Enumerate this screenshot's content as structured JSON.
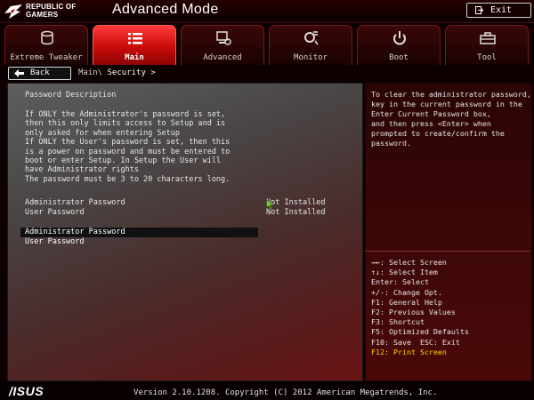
{
  "header": {
    "brand_line1": "REPUBLIC OF",
    "brand_line2": "GAMERS",
    "title": "Advanced Mode",
    "exit_label": "Exit"
  },
  "tabs": [
    {
      "label": "Extreme Tweaker",
      "icon": "extreme-tweaker-icon",
      "active": false
    },
    {
      "label": "Main",
      "icon": "menu-list-icon",
      "active": true
    },
    {
      "label": "Advanced",
      "icon": "advanced-icon",
      "active": false
    },
    {
      "label": "Monitor",
      "icon": "monitor-icon",
      "active": false
    },
    {
      "label": "Boot",
      "icon": "power-icon",
      "active": false
    },
    {
      "label": "Tool",
      "icon": "toolbox-icon",
      "active": false
    }
  ],
  "nav": {
    "back_label": "Back",
    "crumb_parent": "Main\\",
    "crumb_current": "Security >"
  },
  "main": {
    "desc_title": "Password Description",
    "desc_lines": [
      "If ONLY the Administrator's password is set,",
      "then this only limits access to Setup and is",
      "only asked for when entering Setup",
      "If ONLY the User's password is set, then this",
      "is a power on password and must be entered to",
      "boot or enter Setup. In Setup the User will",
      "have Administrator rights",
      "The password must be 3 to 20 characters long."
    ],
    "status_rows": [
      {
        "label": "Administrator Password",
        "value": "Not Installed"
      },
      {
        "label": "User Password",
        "value": "Not Installed"
      }
    ],
    "items": [
      {
        "label": "Administrator Password",
        "selected": true
      },
      {
        "label": "User Password",
        "selected": false
      }
    ]
  },
  "help": {
    "lines": [
      "To clear the administrator password,",
      "key in the current password in the",
      "Enter Current Password box,",
      "and then press <Enter> when",
      "prompted to create/confirm the",
      "password."
    ]
  },
  "keys": [
    {
      "text": "→←: Select Screen",
      "highlight": false
    },
    {
      "text": "↑↓: Select Item",
      "highlight": false
    },
    {
      "text": "Enter: Select",
      "highlight": false
    },
    {
      "text": "+/-: Change Opt.",
      "highlight": false
    },
    {
      "text": "F1: General Help",
      "highlight": false
    },
    {
      "text": "F2: Previous Values",
      "highlight": false
    },
    {
      "text": "F3: Shortcut",
      "highlight": false
    },
    {
      "text": "F5: Optimized Defaults",
      "highlight": false
    },
    {
      "text": "F10: Save  ESC: Exit",
      "highlight": false
    },
    {
      "text": "F12: Print Screen",
      "highlight": true
    }
  ],
  "footer": {
    "logo_text": "/ISUS",
    "version": "Version 2.10.1208. Copyright (C) 2012 American Megatrends, Inc."
  },
  "colors": {
    "active_tab": "#e01414",
    "highlight_key": "#ffd200",
    "selection_bar": "#111111"
  }
}
